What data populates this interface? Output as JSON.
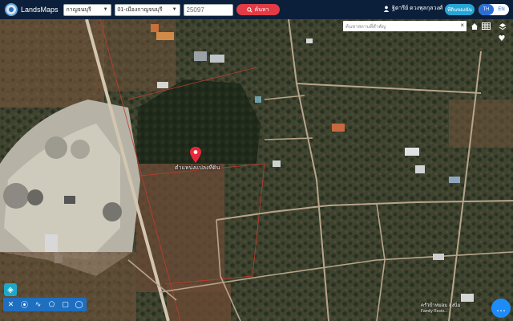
{
  "app": {
    "name": "LandsMaps"
  },
  "search": {
    "province": "กาญจนบุรี",
    "district": "01-เมืองกาญจนบุรี",
    "parcel_no": "25097",
    "button_label": "ค้นหา"
  },
  "user": {
    "name": "ฐิตารีย์ ดวงพุลกุลวงศ์"
  },
  "help_pill": "ที่ดินของฉัน",
  "lang": {
    "th": "TH",
    "en": "EN",
    "active": "EN"
  },
  "map": {
    "place_search_placeholder": "ค้นหาสถานที่สำคัญ",
    "marker_label": "ตำแหน่งแปลงที่ดิน",
    "poi_label": "ครัวป้าหมอม ลุงนิ่ม",
    "poi_sublabel": "Family Resto..."
  },
  "icons": {
    "logo": "globe-logo",
    "search": "search-icon",
    "user": "user-icon",
    "clear": "close-icon",
    "home": "home-icon",
    "grid": "grid-icon",
    "layers": "layers-icon",
    "favorite": "heart-icon",
    "pin": "map-pin-icon",
    "chat": "chat-icon"
  },
  "colors": {
    "topbar": "#0c1f3a",
    "accent_red": "#e23b45",
    "accent_blue": "#2a6fd6",
    "tool_blue": "#1f6fc0"
  }
}
